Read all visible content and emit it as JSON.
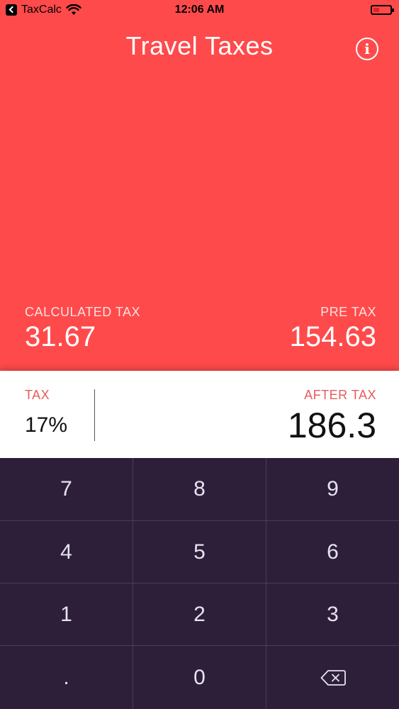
{
  "status_bar": {
    "back_app": "TaxCalc",
    "time": "12:06 AM"
  },
  "header": {
    "title": "Travel Taxes",
    "info_glyph": "i"
  },
  "summary": {
    "calculated_tax_label": "CALCULATED TAX",
    "calculated_tax_value": "31.67",
    "pre_tax_label": "PRE TAX",
    "pre_tax_value": "154.63"
  },
  "result": {
    "tax_label": "TAX",
    "tax_value": "17%",
    "after_tax_label": "AFTER TAX",
    "after_tax_value": "186.3"
  },
  "keypad": {
    "keys": [
      "7",
      "8",
      "9",
      "4",
      "5",
      "6",
      "1",
      "2",
      "3",
      ".",
      "0"
    ]
  },
  "colors": {
    "top_background": "#ff4a4b",
    "keypad_background": "#2d1f3a",
    "label_accent": "#e85a5a"
  },
  "icons": {
    "back": "back-chevron-icon",
    "wifi": "wifi-icon",
    "battery": "battery-icon",
    "info": "info-icon",
    "backspace": "backspace-icon"
  }
}
